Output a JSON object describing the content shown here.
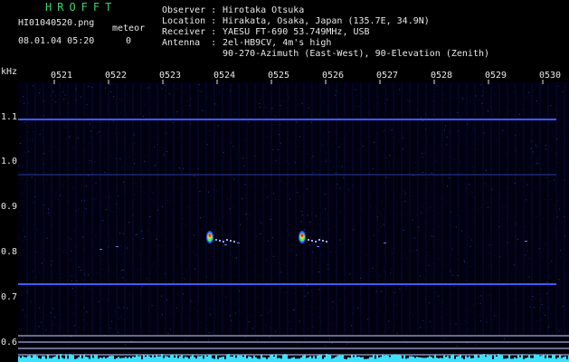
{
  "app": {
    "title": "HROFFT"
  },
  "file": {
    "name": "HI01040520.png",
    "datetime": "08.01.04 05:20"
  },
  "meteor": {
    "label": "meteor",
    "count": "0"
  },
  "info": {
    "observer_label": "Observer :",
    "observer": "Hirotaka Otsuka",
    "location_label": "Location :",
    "location": "Hirakata, Osaka, Japan (135.7E, 34.9N)",
    "receiver_label": "Receiver :",
    "receiver": "YAESU FT-690 53.749MHz, USB",
    "antenna_label": "Antenna  :",
    "antenna_line1": "2el-HB9CV, 4m's high",
    "antenna_line2": "90-270-Azimuth (East-West), 90-Elevation (Zenith)"
  },
  "axis": {
    "unit": "kHz",
    "time_ticks": [
      "0521",
      "0522",
      "0523",
      "0524",
      "0525",
      "0526",
      "0527",
      "0528",
      "0529",
      "0530"
    ],
    "freq_ticks": [
      "1.1",
      "1.0",
      "0.9",
      "0.8",
      "0.7",
      "0.6"
    ]
  },
  "colors": {
    "background": "#000010",
    "signal_line": "#3a5cff",
    "noise": "#0a1440",
    "echo": "#ff3030"
  }
}
